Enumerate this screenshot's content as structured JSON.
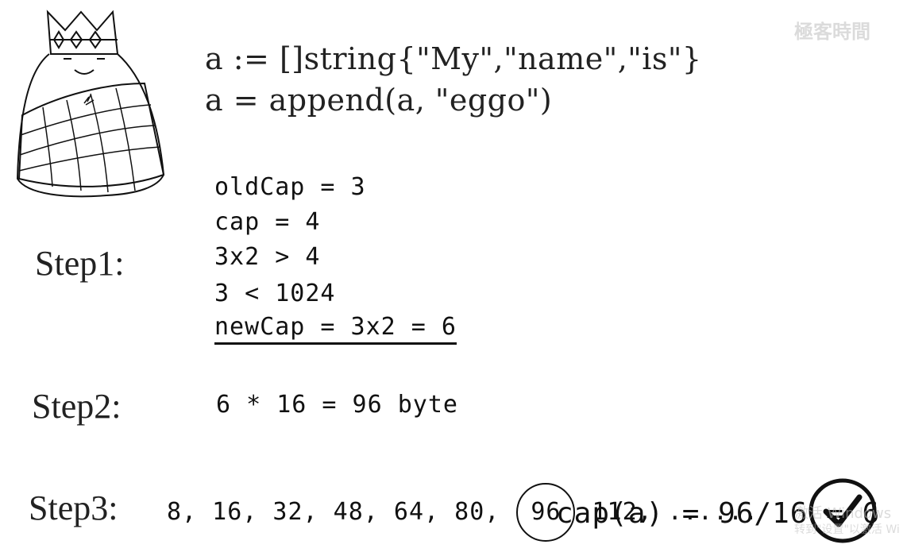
{
  "code": {
    "line1": "a := []string{\"My\",\"name\",\"is\"}",
    "line2": "a = append(a, \"eggo\")"
  },
  "steps": {
    "step1": {
      "label": "Step1:",
      "lines": [
        "oldCap = 3",
        "cap = 4",
        "3x2 > 4",
        "3 < 1024",
        "newCap = 3x2 = 6"
      ]
    },
    "step2": {
      "label": "Step2:",
      "expr": "6 * 16 = 96 byte"
    },
    "step3": {
      "label": "Step3:",
      "sequence_before": "8, 16, 32, 48, 64, 80,",
      "highlighted": "96",
      "sequence_after": "112, ......",
      "result": "cap(a) = 96/16 = 6"
    }
  },
  "watermark": {
    "top_right": "極客時間",
    "activate_line1": "激活 Windows",
    "activate_line2": "转到\"设置\"以激活 Wi"
  },
  "icons": {
    "mascot": "crowned-gopher-icon",
    "check": "checkmark-circle-icon"
  }
}
